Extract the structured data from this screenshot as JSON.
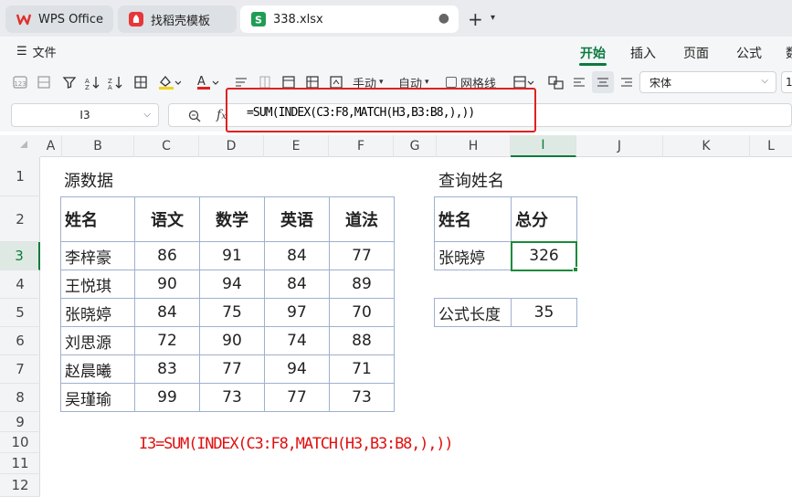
{
  "tabs": {
    "wps": "WPS Office",
    "template": "找稻壳模板",
    "file": "338.xlsx"
  },
  "menu": {
    "file": "文件",
    "ribbon_tabs": [
      "开始",
      "插入",
      "页面",
      "公式",
      "数"
    ]
  },
  "toolbar": {
    "manual": "手动",
    "auto": "自动",
    "gridlines": "网格线",
    "font": "宋体",
    "size": "1"
  },
  "formula_bar": {
    "cell_ref": "I3",
    "fx": "fx",
    "formula": "=SUM(INDEX(C3:F8,MATCH(H3,B3:B8,),))"
  },
  "grid": {
    "columns": [
      "A",
      "B",
      "C",
      "D",
      "E",
      "F",
      "G",
      "H",
      "I",
      "J",
      "K",
      "L"
    ],
    "active_column": "I",
    "rows": [
      "1",
      "2",
      "3",
      "4",
      "5",
      "6",
      "7",
      "8",
      "9",
      "10",
      "11",
      "12"
    ],
    "active_row": "3"
  },
  "sheet": {
    "source_label": "源数据",
    "query_label": "查询姓名",
    "source_table": {
      "headers": [
        "姓名",
        "语文",
        "数学",
        "英语",
        "道法"
      ],
      "rows": [
        [
          "李梓豪",
          "86",
          "91",
          "84",
          "77"
        ],
        [
          "王悦琪",
          "90",
          "94",
          "84",
          "89"
        ],
        [
          "张晓婷",
          "84",
          "75",
          "97",
          "70"
        ],
        [
          "刘思源",
          "72",
          "90",
          "74",
          "88"
        ],
        [
          "赵晨曦",
          "83",
          "77",
          "94",
          "71"
        ],
        [
          "吴瑾瑜",
          "99",
          "73",
          "77",
          "73"
        ]
      ]
    },
    "query_table": {
      "headers": [
        "姓名",
        "总分"
      ],
      "name": "张晓婷",
      "total": "326"
    },
    "length_label": "公式长度",
    "length_value": "35",
    "note": "I3=SUM(INDEX(C3:F8,MATCH(H3,B3:B8,),))"
  },
  "colors": {
    "accent": "#0a7a3e",
    "highlight": "#e02020",
    "note": "#e01010",
    "table_border": "#9fb0cf"
  }
}
